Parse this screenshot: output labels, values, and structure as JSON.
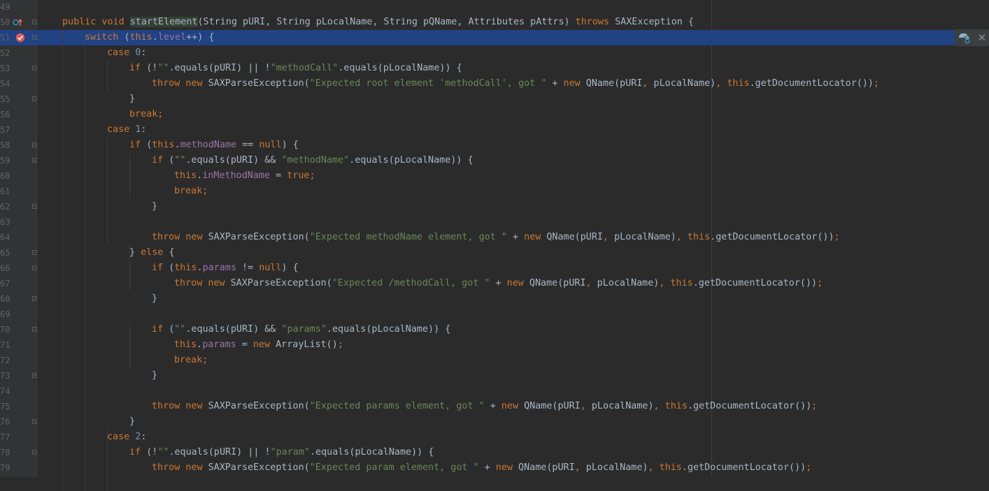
{
  "editor": {
    "current_line": 51,
    "lines": [
      {
        "num": "49",
        "indent": 0,
        "fold": false,
        "tokens": []
      },
      {
        "num": "50",
        "indent": 0,
        "fold": true,
        "tokens": [
          [
            "kw",
            "public void "
          ],
          [
            "hl",
            "startElement"
          ],
          [
            "",
            "(String pURI, String pLocalName, String pQName, Attributes pAttrs) "
          ],
          [
            "kw",
            "throws "
          ],
          [
            "",
            "SAXException {"
          ]
        ]
      },
      {
        "num": "51",
        "indent": 1,
        "fold": true,
        "tokens": [
          [
            "kw",
            "switch "
          ],
          [
            "",
            "("
          ],
          [
            "kw",
            "this"
          ],
          [
            "",
            "."
          ],
          [
            "fld",
            "level"
          ],
          [
            "",
            "++) {"
          ]
        ]
      },
      {
        "num": "52",
        "indent": 2,
        "fold": false,
        "tokens": [
          [
            "kw",
            "case "
          ],
          [
            "num",
            "0"
          ],
          [
            "",
            ":"
          ]
        ]
      },
      {
        "num": "53",
        "indent": 3,
        "fold": true,
        "tokens": [
          [
            "kw",
            "if "
          ],
          [
            "",
            "(!"
          ],
          [
            "str",
            "\"\""
          ],
          [
            "",
            ".equals(pURI) || !"
          ],
          [
            "str",
            "\"methodCall\""
          ],
          [
            "",
            ".equals(pLocalName)) {"
          ]
        ]
      },
      {
        "num": "54",
        "indent": 4,
        "fold": false,
        "tokens": [
          [
            "kw",
            "throw new "
          ],
          [
            "",
            "SAXParseException("
          ],
          [
            "str",
            "\"Expected root element 'methodCall', got \""
          ],
          [
            "",
            " + "
          ],
          [
            "kw",
            "new "
          ],
          [
            "",
            "QName(pURI"
          ],
          [
            "kw",
            ", "
          ],
          [
            "",
            "pLocalName)"
          ],
          [
            "kw",
            ", "
          ],
          [
            "kw",
            "this"
          ],
          [
            "",
            ".getDocumentLocator())"
          ],
          [
            "kw",
            ";"
          ]
        ]
      },
      {
        "num": "55",
        "indent": 3,
        "fold": true,
        "tokens": [
          [
            "",
            "}"
          ]
        ]
      },
      {
        "num": "56",
        "indent": 3,
        "fold": false,
        "tokens": [
          [
            "kw",
            "break;"
          ]
        ]
      },
      {
        "num": "57",
        "indent": 2,
        "fold": false,
        "tokens": [
          [
            "kw",
            "case "
          ],
          [
            "num",
            "1"
          ],
          [
            "",
            ":"
          ]
        ]
      },
      {
        "num": "58",
        "indent": 3,
        "fold": true,
        "tokens": [
          [
            "kw",
            "if "
          ],
          [
            "",
            "("
          ],
          [
            "kw",
            "this"
          ],
          [
            "",
            "."
          ],
          [
            "fld",
            "methodName"
          ],
          [
            "",
            " == "
          ],
          [
            "kw",
            "null"
          ],
          [
            "",
            ") {"
          ]
        ]
      },
      {
        "num": "59",
        "indent": 4,
        "fold": true,
        "tokens": [
          [
            "kw",
            "if "
          ],
          [
            "",
            "("
          ],
          [
            "str",
            "\"\""
          ],
          [
            "",
            ".equals(pURI) && "
          ],
          [
            "str",
            "\"methodName\""
          ],
          [
            "",
            ".equals(pLocalName)) {"
          ]
        ]
      },
      {
        "num": "60",
        "indent": 5,
        "fold": false,
        "tokens": [
          [
            "kw",
            "this"
          ],
          [
            "",
            "."
          ],
          [
            "fld",
            "inMethodName"
          ],
          [
            "",
            " = "
          ],
          [
            "kw",
            "true;"
          ]
        ]
      },
      {
        "num": "61",
        "indent": 5,
        "fold": false,
        "tokens": [
          [
            "kw",
            "break;"
          ]
        ]
      },
      {
        "num": "62",
        "indent": 4,
        "fold": true,
        "tokens": [
          [
            "",
            "}"
          ]
        ]
      },
      {
        "num": "63",
        "indent": 0,
        "fold": false,
        "tokens": []
      },
      {
        "num": "64",
        "indent": 4,
        "fold": false,
        "tokens": [
          [
            "kw",
            "throw new "
          ],
          [
            "",
            "SAXParseException("
          ],
          [
            "str",
            "\"Expected methodName element, got \""
          ],
          [
            "",
            " + "
          ],
          [
            "kw",
            "new "
          ],
          [
            "",
            "QName(pURI"
          ],
          [
            "kw",
            ", "
          ],
          [
            "",
            "pLocalName)"
          ],
          [
            "kw",
            ", "
          ],
          [
            "kw",
            "this"
          ],
          [
            "",
            ".getDocumentLocator())"
          ],
          [
            "kw",
            ";"
          ]
        ]
      },
      {
        "num": "65",
        "indent": 3,
        "fold": true,
        "tokens": [
          [
            "",
            "} "
          ],
          [
            "kw",
            "else "
          ],
          [
            "",
            "{"
          ]
        ]
      },
      {
        "num": "66",
        "indent": 4,
        "fold": true,
        "tokens": [
          [
            "kw",
            "if "
          ],
          [
            "",
            "("
          ],
          [
            "kw",
            "this"
          ],
          [
            "",
            "."
          ],
          [
            "fld",
            "params"
          ],
          [
            "",
            " != "
          ],
          [
            "kw",
            "null"
          ],
          [
            "",
            ") {"
          ]
        ]
      },
      {
        "num": "67",
        "indent": 5,
        "fold": false,
        "tokens": [
          [
            "kw",
            "throw new "
          ],
          [
            "",
            "SAXParseException("
          ],
          [
            "str",
            "\"Expected /methodCall, got \""
          ],
          [
            "",
            " + "
          ],
          [
            "kw",
            "new "
          ],
          [
            "",
            "QName(pURI"
          ],
          [
            "kw",
            ", "
          ],
          [
            "",
            "pLocalName)"
          ],
          [
            "kw",
            ", "
          ],
          [
            "kw",
            "this"
          ],
          [
            "",
            ".getDocumentLocator())"
          ],
          [
            "kw",
            ";"
          ]
        ]
      },
      {
        "num": "68",
        "indent": 4,
        "fold": true,
        "tokens": [
          [
            "",
            "}"
          ]
        ]
      },
      {
        "num": "69",
        "indent": 0,
        "fold": false,
        "tokens": []
      },
      {
        "num": "70",
        "indent": 4,
        "fold": true,
        "tokens": [
          [
            "kw",
            "if "
          ],
          [
            "",
            "("
          ],
          [
            "str",
            "\"\""
          ],
          [
            "",
            ".equals(pURI) && "
          ],
          [
            "str",
            "\"params\""
          ],
          [
            "",
            ".equals(pLocalName)) {"
          ]
        ]
      },
      {
        "num": "71",
        "indent": 5,
        "fold": false,
        "tokens": [
          [
            "kw",
            "this"
          ],
          [
            "",
            "."
          ],
          [
            "fld",
            "params"
          ],
          [
            "",
            " = "
          ],
          [
            "kw",
            "new "
          ],
          [
            "",
            "ArrayList()"
          ],
          [
            "kw",
            ";"
          ]
        ]
      },
      {
        "num": "72",
        "indent": 5,
        "fold": false,
        "tokens": [
          [
            "kw",
            "break;"
          ]
        ]
      },
      {
        "num": "73",
        "indent": 4,
        "fold": true,
        "tokens": [
          [
            "",
            "}"
          ]
        ]
      },
      {
        "num": "74",
        "indent": 0,
        "fold": false,
        "tokens": []
      },
      {
        "num": "75",
        "indent": 4,
        "fold": false,
        "tokens": [
          [
            "kw",
            "throw new "
          ],
          [
            "",
            "SAXParseException("
          ],
          [
            "str",
            "\"Expected params element, got \""
          ],
          [
            "",
            " + "
          ],
          [
            "kw",
            "new "
          ],
          [
            "",
            "QName(pURI"
          ],
          [
            "kw",
            ", "
          ],
          [
            "",
            "pLocalName)"
          ],
          [
            "kw",
            ", "
          ],
          [
            "kw",
            "this"
          ],
          [
            "",
            ".getDocumentLocator())"
          ],
          [
            "kw",
            ";"
          ]
        ]
      },
      {
        "num": "76",
        "indent": 3,
        "fold": true,
        "tokens": [
          [
            "",
            "}"
          ]
        ]
      },
      {
        "num": "77",
        "indent": 2,
        "fold": false,
        "tokens": [
          [
            "kw",
            "case "
          ],
          [
            "num",
            "2"
          ],
          [
            "",
            ":"
          ]
        ]
      },
      {
        "num": "78",
        "indent": 3,
        "fold": true,
        "tokens": [
          [
            "kw",
            "if "
          ],
          [
            "",
            "(!"
          ],
          [
            "str",
            "\"\""
          ],
          [
            "",
            ".equals(pURI) || !"
          ],
          [
            "str",
            "\"param\""
          ],
          [
            "",
            ".equals(pLocalName)) {"
          ]
        ]
      },
      {
        "num": "79",
        "indent": 4,
        "fold": false,
        "tokens": [
          [
            "kw",
            "throw new "
          ],
          [
            "",
            "SAXParseException("
          ],
          [
            "str",
            "\"Expected param element, got \""
          ],
          [
            "",
            " + "
          ],
          [
            "kw",
            "new "
          ],
          [
            "",
            "QName(pURI"
          ],
          [
            "kw",
            ", "
          ],
          [
            "",
            "pLocalName)"
          ],
          [
            "kw",
            ", "
          ],
          [
            "kw",
            "this"
          ],
          [
            "",
            ".getDocumentLocator())"
          ],
          [
            "kw",
            ";"
          ]
        ]
      }
    ]
  },
  "icons": {
    "override": "override-method-icon",
    "breakpoint": "breakpoint-icon",
    "reload": "reload-changes-icon",
    "close": "close-icon"
  },
  "toolbar": {
    "close_glyph": "✕"
  },
  "colors": {
    "background": "#2b2b2b",
    "gutter": "#313335",
    "current_line": "#214283",
    "keyword": "#cc7832",
    "string": "#6a8759",
    "field": "#9876aa",
    "number": "#6897bb",
    "breakpoint": "#db5c5c"
  }
}
